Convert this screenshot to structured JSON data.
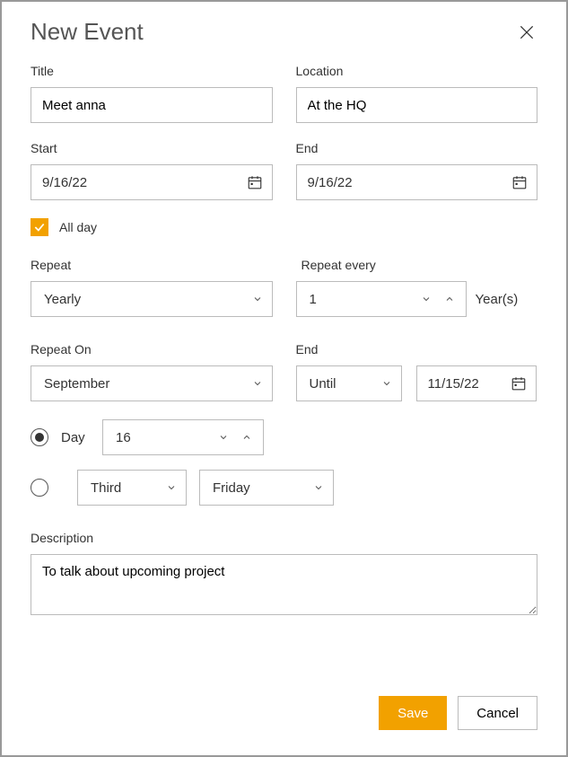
{
  "dialog": {
    "title": "New Event"
  },
  "fields": {
    "title_label": "Title",
    "title_value": "Meet anna",
    "location_label": "Location",
    "location_value": "At the HQ",
    "start_label": "Start",
    "start_value": "9/16/22",
    "end_label": "End",
    "end_value": "9/16/22",
    "allday_label": "All day",
    "allday_checked": true,
    "repeat_label": "Repeat",
    "repeat_value": "Yearly",
    "repeat_every_label": "Repeat every",
    "repeat_every_value": "1",
    "repeat_every_unit": "Year(s)",
    "repeat_on_label": "Repeat On",
    "repeat_on_month": "September",
    "recurrence_end_label": "End",
    "recurrence_end_mode": "Until",
    "recurrence_end_date": "11/15/22",
    "day_option_label": "Day",
    "day_option_value": "16",
    "day_option_selected": true,
    "ordinal_value": "Third",
    "weekday_value": "Friday",
    "ordinal_option_selected": false,
    "description_label": "Description",
    "description_value": "To talk about upcoming project"
  },
  "buttons": {
    "save": "Save",
    "cancel": "Cancel"
  }
}
